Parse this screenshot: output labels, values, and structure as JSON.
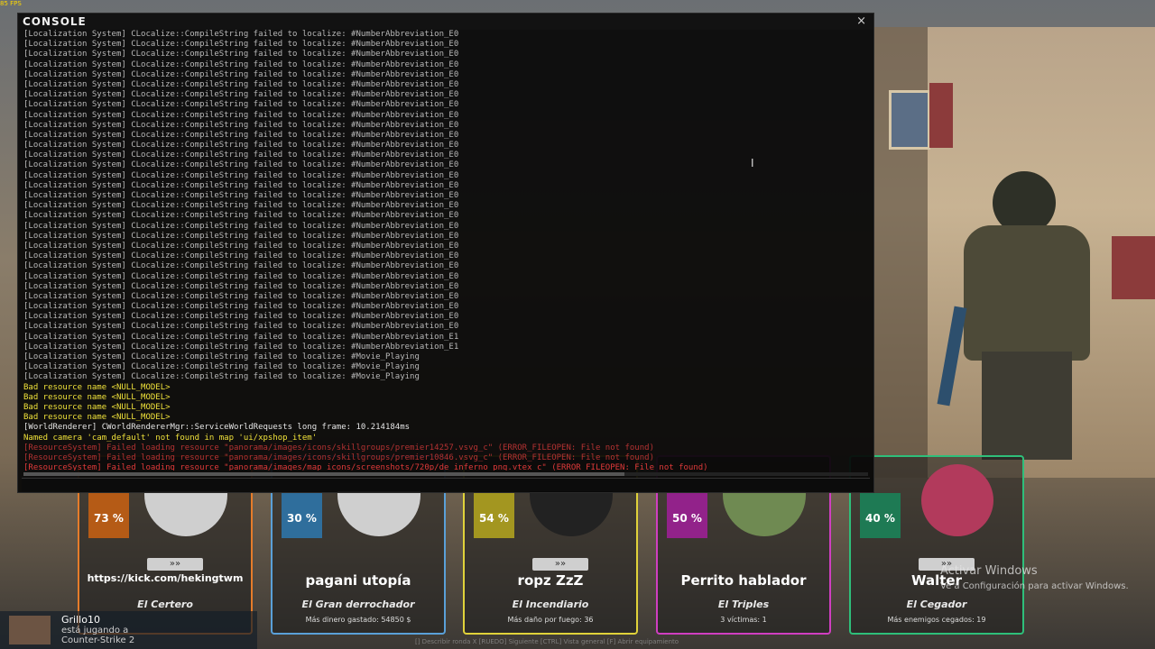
{
  "fps": "85 FPS",
  "console": {
    "title": "CONSOLE",
    "close": "×",
    "lines": [
      {
        "t": "[Localization System] CLocalize::CompileString failed to localize: #NumberAbbreviation_E0",
        "c": "gray"
      },
      {
        "t": "[Localization System] CLocalize::CompileString failed to localize: #NumberAbbreviation_E0",
        "c": "gray"
      },
      {
        "t": "[Localization System] CLocalize::CompileString failed to localize: #NumberAbbreviation_E0",
        "c": "gray"
      },
      {
        "t": "[Localization System] CLocalize::CompileString failed to localize: #NumberAbbreviation_E0",
        "c": "gray"
      },
      {
        "t": "[Localization System] CLocalize::CompileString failed to localize: #NumberAbbreviation_E0",
        "c": "gray"
      },
      {
        "t": "[Localization System] CLocalize::CompileString failed to localize: #NumberAbbreviation_E0",
        "c": "gray"
      },
      {
        "t": "[Localization System] CLocalize::CompileString failed to localize: #NumberAbbreviation_E0",
        "c": "gray"
      },
      {
        "t": "[Localization System] CLocalize::CompileString failed to localize: #NumberAbbreviation_E0",
        "c": "gray"
      },
      {
        "t": "[Localization System] CLocalize::CompileString failed to localize: #NumberAbbreviation_E0",
        "c": "gray"
      },
      {
        "t": "[Localization System] CLocalize::CompileString failed to localize: #NumberAbbreviation_E0",
        "c": "gray"
      },
      {
        "t": "[Localization System] CLocalize::CompileString failed to localize: #NumberAbbreviation_E0",
        "c": "gray"
      },
      {
        "t": "[Localization System] CLocalize::CompileString failed to localize: #NumberAbbreviation_E0",
        "c": "gray"
      },
      {
        "t": "[Localization System] CLocalize::CompileString failed to localize: #NumberAbbreviation_E0",
        "c": "gray"
      },
      {
        "t": "[Localization System] CLocalize::CompileString failed to localize: #NumberAbbreviation_E0",
        "c": "gray"
      },
      {
        "t": "[Localization System] CLocalize::CompileString failed to localize: #NumberAbbreviation_E0",
        "c": "gray"
      },
      {
        "t": "[Localization System] CLocalize::CompileString failed to localize: #NumberAbbreviation_E0",
        "c": "gray"
      },
      {
        "t": "[Localization System] CLocalize::CompileString failed to localize: #NumberAbbreviation_E0",
        "c": "gray"
      },
      {
        "t": "[Localization System] CLocalize::CompileString failed to localize: #NumberAbbreviation_E0",
        "c": "gray"
      },
      {
        "t": "[Localization System] CLocalize::CompileString failed to localize: #NumberAbbreviation_E0",
        "c": "gray"
      },
      {
        "t": "[Localization System] CLocalize::CompileString failed to localize: #NumberAbbreviation_E0",
        "c": "gray"
      },
      {
        "t": "[Localization System] CLocalize::CompileString failed to localize: #NumberAbbreviation_E0",
        "c": "gray"
      },
      {
        "t": "[Localization System] CLocalize::CompileString failed to localize: #NumberAbbreviation_E0",
        "c": "gray"
      },
      {
        "t": "[Localization System] CLocalize::CompileString failed to localize: #NumberAbbreviation_E0",
        "c": "gray"
      },
      {
        "t": "[Localization System] CLocalize::CompileString failed to localize: #NumberAbbreviation_E0",
        "c": "gray"
      },
      {
        "t": "[Localization System] CLocalize::CompileString failed to localize: #NumberAbbreviation_E0",
        "c": "gray"
      },
      {
        "t": "[Localization System] CLocalize::CompileString failed to localize: #NumberAbbreviation_E0",
        "c": "gray"
      },
      {
        "t": "[Localization System] CLocalize::CompileString failed to localize: #NumberAbbreviation_E0",
        "c": "gray"
      },
      {
        "t": "[Localization System] CLocalize::CompileString failed to localize: #NumberAbbreviation_E0",
        "c": "gray"
      },
      {
        "t": "[Localization System] CLocalize::CompileString failed to localize: #NumberAbbreviation_E0",
        "c": "gray"
      },
      {
        "t": "[Localization System] CLocalize::CompileString failed to localize: #NumberAbbreviation_E0",
        "c": "gray"
      },
      {
        "t": "[Localization System] CLocalize::CompileString failed to localize: #NumberAbbreviation_E1",
        "c": "gray"
      },
      {
        "t": "[Localization System] CLocalize::CompileString failed to localize: #NumberAbbreviation_E1",
        "c": "gray"
      },
      {
        "t": "[Localization System] CLocalize::CompileString failed to localize: #Movie_Playing",
        "c": "gray"
      },
      {
        "t": "[Localization System] CLocalize::CompileString failed to localize: #Movie_Playing",
        "c": "gray"
      },
      {
        "t": "[Localization System] CLocalize::CompileString failed to localize: #Movie_Playing",
        "c": "gray"
      },
      {
        "t": "Bad resource name <NULL_MODEL>",
        "c": "yellow"
      },
      {
        "t": "Bad resource name <NULL_MODEL>",
        "c": "yellow"
      },
      {
        "t": "Bad resource name <NULL_MODEL>",
        "c": "yellow"
      },
      {
        "t": "Bad resource name <NULL_MODEL>",
        "c": "yellow"
      },
      {
        "t": "[WorldRenderer] CWorldRendererMgr::ServiceWorldRequests long frame: 10.214184ms",
        "c": "white"
      },
      {
        "t": "Named camera 'cam_default' not found in map 'ui/xpshop_item'",
        "c": "yellow"
      },
      {
        "t": "[ResourceSystem] Failed loading resource \"panorama/images/icons/skillgroups/premier14257.vsvg_c\" (ERROR_FILEOPEN: File not found)",
        "c": "redsoft"
      },
      {
        "t": "[ResourceSystem] Failed loading resource \"panorama/images/icons/skillgroups/premier10846.vsvg_c\" (ERROR_FILEOPEN: File not found)",
        "c": "redsoft"
      },
      {
        "t": "[ResourceSystem] Failed loading resource \"panorama/images/map_icons/screenshots/720p/de_inferno_png.vtex_c\" (ERROR_FILEOPEN: File not found)",
        "c": "red"
      }
    ]
  },
  "cards": [
    {
      "pct": "73 %",
      "name": "https://kick.com/hekingtwm",
      "title": "El Certero",
      "sub": ""
    },
    {
      "pct": "30 %",
      "name": "pagani utopía",
      "title": "El Gran derrochador",
      "sub": "Más dinero gastado: 54850 $"
    },
    {
      "pct": "54 %",
      "name": "ropz ZzZ",
      "title": "El Incendiario",
      "sub": "Más daño por fuego: 36"
    },
    {
      "pct": "50 %",
      "name": "Perrito hablador",
      "title": "El Triples",
      "sub": "3 víctimas: 1"
    },
    {
      "pct": "40 %",
      "name": "Walter",
      "title": "El Cegador",
      "sub": "Más enemigos cegados: 19"
    }
  ],
  "activate_windows": {
    "line1": "Activar Windows",
    "line2": "Ve a Configuración para activar Windows."
  },
  "friend": {
    "name": "Grillo10",
    "status1": "está jugando a",
    "status2": "Counter-Strike 2"
  },
  "hints": "[] Describir ronda X   [RUEDO] Siguiente   [CTRL] Vista general   [F] Abrir equipamiento"
}
